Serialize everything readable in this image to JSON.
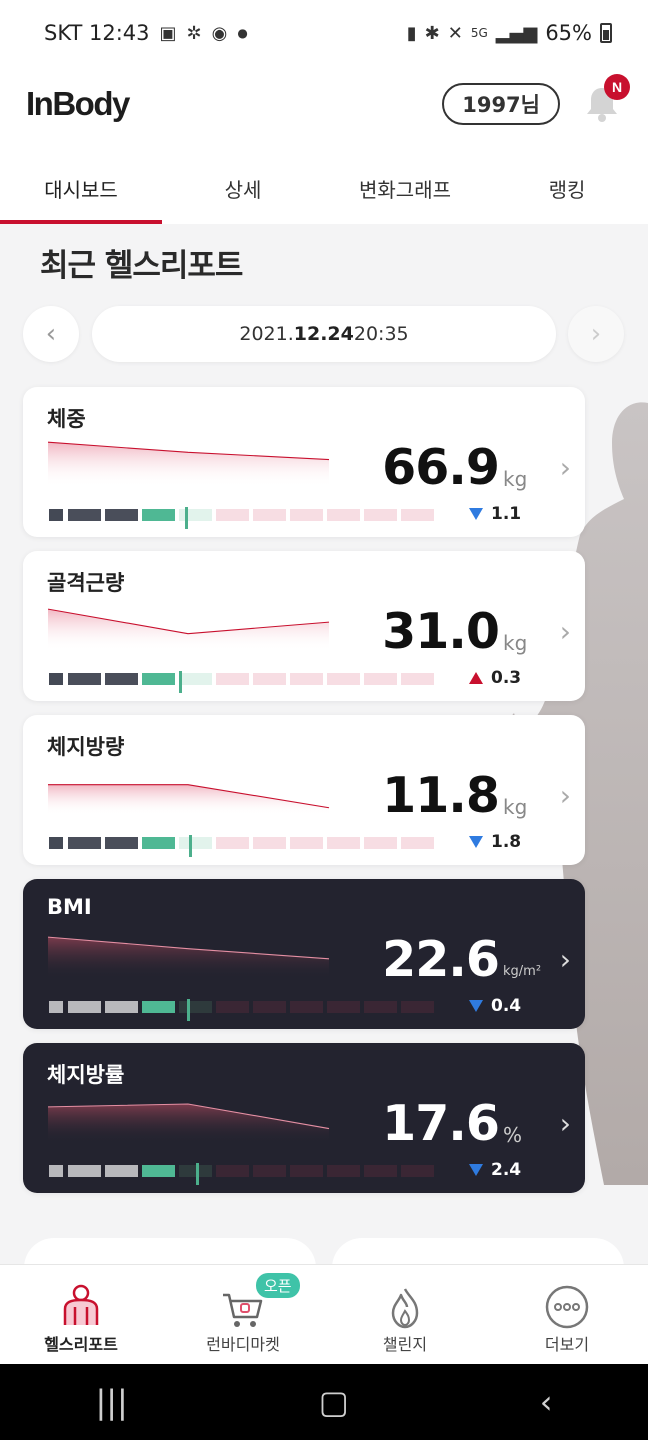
{
  "status_bar": {
    "carrier_time": "SKT 12:43",
    "battery": "65%",
    "icons": [
      "gallery-icon",
      "app-icon",
      "starbucks-icon",
      "dot-icon",
      "cleaner-icon",
      "bluetooth-icon",
      "mute-icon",
      "5g-icon",
      "signal-icon",
      "battery-icon"
    ]
  },
  "app_bar": {
    "logo": "InBody",
    "user_label": "1997님",
    "notification_badge": "N"
  },
  "tabs": [
    {
      "label": "대시보드",
      "active": true
    },
    {
      "label": "상세",
      "active": false
    },
    {
      "label": "변화그래프",
      "active": false
    },
    {
      "label": "랭킹",
      "active": false
    }
  ],
  "section_title": "최근 헬스리포트",
  "date": {
    "prefix": "2021.",
    "highlight": "12.24",
    "suffix": " 20:35"
  },
  "cards": [
    {
      "label": "체중",
      "value": "66.9",
      "unit": "kg",
      "delta": "1.1",
      "direction": "down",
      "theme": "light",
      "gauge_fill": 0.35
    },
    {
      "label": "골격근량",
      "value": "31.0",
      "unit": "kg",
      "delta": "0.3",
      "direction": "up",
      "theme": "light",
      "gauge_fill": 0.335
    },
    {
      "label": "체지방량",
      "value": "11.8",
      "unit": "kg",
      "delta": "1.8",
      "direction": "down",
      "theme": "light",
      "gauge_fill": 0.36
    },
    {
      "label": "BMI",
      "value": "22.6",
      "unit": "kg/m²",
      "delta": "0.4",
      "direction": "down",
      "theme": "dark",
      "gauge_fill": 0.355
    },
    {
      "label": "체지방률",
      "value": "17.6",
      "unit": "%",
      "delta": "2.4",
      "direction": "down",
      "theme": "dark",
      "gauge_fill": 0.38
    }
  ],
  "bottom_nav": [
    {
      "label": "헬스리포트",
      "icon": "health-report-icon",
      "active": true
    },
    {
      "label": "런바디마켓",
      "icon": "cart-icon",
      "active": false,
      "badge": "오픈"
    },
    {
      "label": "챌린지",
      "icon": "flame-icon",
      "active": false
    },
    {
      "label": "더보기",
      "icon": "more-icon",
      "active": false
    }
  ],
  "colors": {
    "accent": "#c8102e",
    "normal": "#4fb894",
    "dark_card": "#23232f",
    "under": "#4a4d57",
    "over": "#f5dde2"
  }
}
